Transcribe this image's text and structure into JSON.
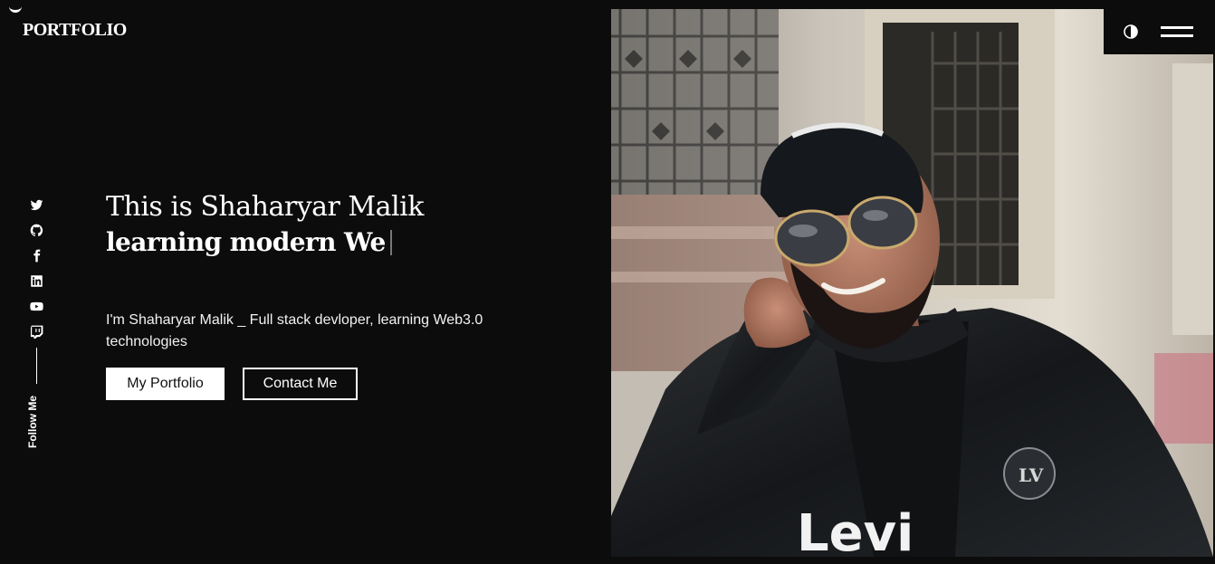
{
  "header": {
    "brand": "PORTFOLIO"
  },
  "social": {
    "icons": [
      "twitter-icon",
      "github-icon",
      "facebook-icon",
      "linkedin-icon",
      "youtube-icon",
      "twitch-icon"
    ],
    "follow_label": "Follow Me"
  },
  "hero": {
    "title_line1": "This is Shaharyar Malik",
    "title_line2": "learning modern We",
    "description": "I'm Shaharyar Malik _ Full stack devloper, learning Web3.0 technologies",
    "primary_button": "My Portfolio",
    "secondary_button": "Contact Me"
  },
  "colors": {
    "background": "#0c0c0c",
    "text": "#ffffff",
    "accent": "#ffffff"
  }
}
